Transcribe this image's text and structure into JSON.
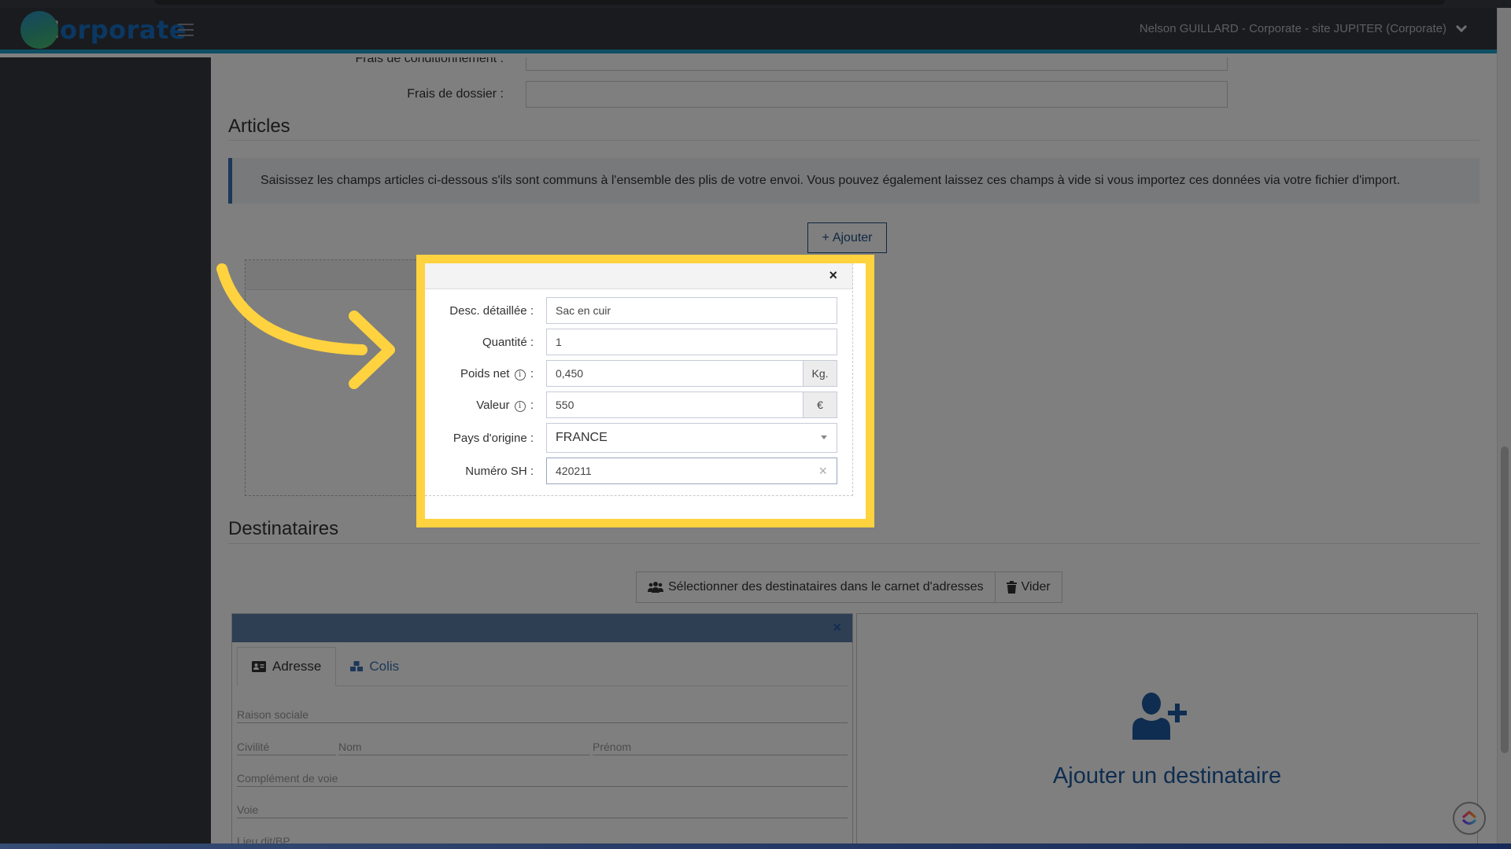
{
  "app": {
    "logo_first_letter": "C",
    "logo_rest": "orporate",
    "user_menu_label": "Nelson GUILLARD - Corporate - site JUPITER (Corporate)"
  },
  "form_top": {
    "fields": [
      {
        "label": "Frais de conditionnement :",
        "value": ""
      },
      {
        "label": "Frais de dossier :",
        "value": ""
      }
    ]
  },
  "articles": {
    "title": "Articles",
    "info_text": "Saisissez les champs articles ci-dessous s'ils sont communs à l'ensemble des plis de votre envoi. Vous pouvez également laissez ces champs à vide si vous importez ces données via votre fichier d'import.",
    "add_button": "Ajouter",
    "add_icon_glyph": "+"
  },
  "article_form": {
    "close_glyph": "×",
    "desc": {
      "label": "Desc. détaillée :",
      "value": "Sac en cuir"
    },
    "quantite": {
      "label": "Quantité :",
      "value": "1"
    },
    "poids": {
      "label": "Poids net",
      "suffix": ":",
      "value": "0,450",
      "unit": "Kg."
    },
    "valeur": {
      "label": "Valeur",
      "suffix": ":",
      "value": "550",
      "unit": "€"
    },
    "pays": {
      "label": "Pays d'origine :",
      "value": "FRANCE"
    },
    "sh": {
      "label": "Numéro SH :",
      "value": "420211",
      "clear_glyph": "×"
    },
    "info_glyph": "i"
  },
  "destinataires": {
    "title": "Destinataires",
    "select_button": "Sélectionner des destinataires dans le carnet d'adresses",
    "clear_button": "Vider",
    "card": {
      "close_glyph": "×",
      "tabs": [
        {
          "label": "Adresse",
          "active": true
        },
        {
          "label": "Colis",
          "active": false
        }
      ],
      "fields": {
        "raison_sociale": "Raison sociale",
        "civilite": "Civilité",
        "nom": "Nom",
        "prenom": "Prénom",
        "complement": "Complément de voie",
        "voie": "Voie",
        "lieu_dit": "Lieu dit/BP"
      }
    },
    "add_card_label": "Ajouter un destinataire"
  },
  "colors": {
    "accent": "#1a9fc9",
    "brand_blue": "#1e5aa0",
    "highlight": "#ffd23f"
  }
}
